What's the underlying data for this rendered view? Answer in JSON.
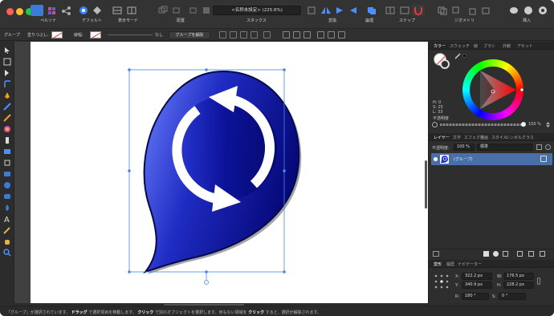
{
  "toolbar": {
    "persona": "ペルソナ",
    "default": "デフォルト",
    "display_mode": "表示モード",
    "arrange": "配置",
    "stacks": "スタックス",
    "zoom_field": "<名称未設定> (225.6%)",
    "transform": "変換",
    "boolean": "論理",
    "snap": "スナップ",
    "geometry": "ジオメトリ",
    "insert": "挿入"
  },
  "context_bar": {
    "group_label": "グループ",
    "fill_label": "塗りつぶし:",
    "stroke_label": "線幅:",
    "none_label": "なし",
    "ungroup_button": "グループを解除"
  },
  "right_panel": {
    "top_tabs": [
      "カラー",
      "スウォッチ",
      "線",
      "ブラシ",
      "外観",
      "アセット"
    ],
    "hsl": {
      "h": "H: 0",
      "s": "S: 25",
      "l": "L: 33"
    },
    "opacity_label": "不透明度",
    "opacity_value": "100 %",
    "layer_tabs": [
      "レイヤー",
      "文字",
      "エフェクト",
      "描画",
      "スタイル",
      "シンボル",
      "クラス"
    ],
    "layer_opacity_label": "不透明度:",
    "layer_opacity_value": "100 %",
    "blend_mode": "標準",
    "layer_name": "(グループ)",
    "transform_tabs": [
      "変形",
      "履歴",
      "ナビゲーター"
    ],
    "x": "322.2 px",
    "y": "340.9 px",
    "w": "176.5 px",
    "h": "228.2 px",
    "r": "180 °",
    "s": "0 °",
    "labels": {
      "x": "X:",
      "y": "Y:",
      "w": "W:",
      "h": "H:",
      "r": "R:",
      "s": "S:"
    }
  },
  "status": {
    "part1": "「グループ」が選択されています。",
    "drag": "ドラッグ",
    "part2": "で選択項目を移動します。",
    "click": "クリック",
    "part3": "で別のオブジェクトを選択します。何もない領域を",
    "click2": "クリック",
    "part4": "すると、選択が解除されます。"
  },
  "colors": {
    "accent": "#3b82f6",
    "icon_blue_dark": "#0a0f8a",
    "icon_blue_light": "#6b82ff",
    "layer_highlight": "#4a6fa8"
  }
}
